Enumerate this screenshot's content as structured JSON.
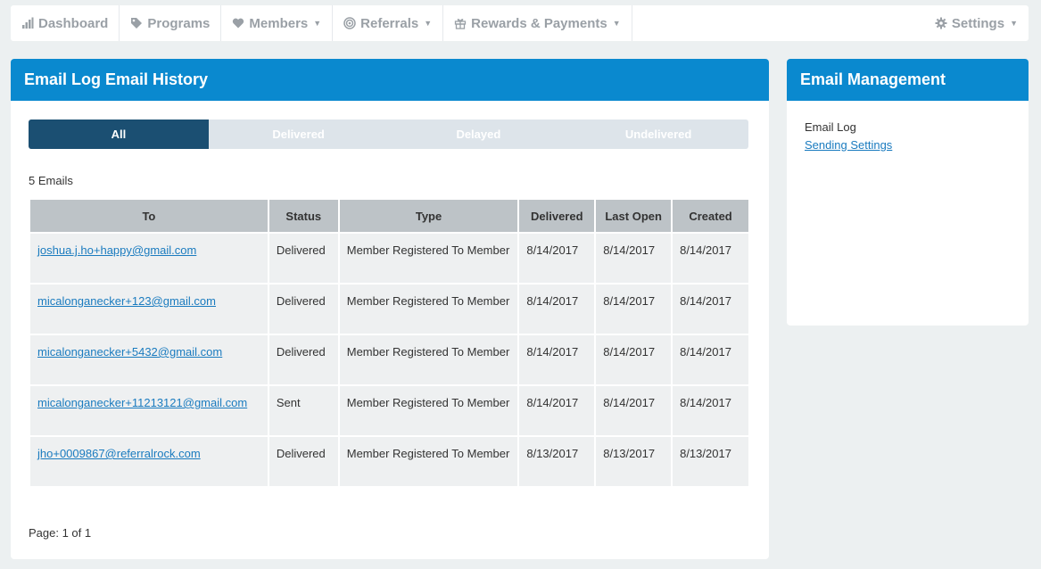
{
  "nav": {
    "dashboard": "Dashboard",
    "programs": "Programs",
    "members": "Members",
    "referrals": "Referrals",
    "rewards": "Rewards & Payments",
    "settings": "Settings"
  },
  "main": {
    "title": "Email Log Email History",
    "tabs": [
      "All",
      "Delivered",
      "Delayed",
      "Undelivered"
    ],
    "active_tab": "All",
    "count": "5 Emails",
    "columns": [
      "To",
      "Status",
      "Type",
      "Delivered",
      "Last Open",
      "Created"
    ],
    "rows": [
      {
        "to": "joshua.j.ho+happy@gmail.com",
        "status": "Delivered",
        "type": "Member Registered To Member",
        "delivered": "8/14/2017",
        "last_open": "8/14/2017",
        "created": "8/14/2017"
      },
      {
        "to": "micalonganecker+123@gmail.com",
        "status": "Delivered",
        "type": "Member Registered To Member",
        "delivered": "8/14/2017",
        "last_open": "8/14/2017",
        "created": "8/14/2017"
      },
      {
        "to": "micalonganecker+5432@gmail.com",
        "status": "Delivered",
        "type": "Member Registered To Member",
        "delivered": "8/14/2017",
        "last_open": "8/14/2017",
        "created": "8/14/2017"
      },
      {
        "to": "micalonganecker+11213121@gmail.com",
        "status": "Sent",
        "type": "Member Registered To Member",
        "delivered": "8/14/2017",
        "last_open": "8/14/2017",
        "created": "8/14/2017"
      },
      {
        "to": "jho+0009867@referralrock.com",
        "status": "Delivered",
        "type": "Member Registered To Member",
        "delivered": "8/13/2017",
        "last_open": "8/13/2017",
        "created": "8/13/2017"
      }
    ],
    "pager": "Page: 1 of 1"
  },
  "side": {
    "title": "Email Management",
    "items": [
      "Email Log",
      "Sending Settings"
    ]
  },
  "colors": {
    "header_blue": "#0a89cf",
    "active_tab": "#1b4f72",
    "link": "#1a7bbf"
  }
}
